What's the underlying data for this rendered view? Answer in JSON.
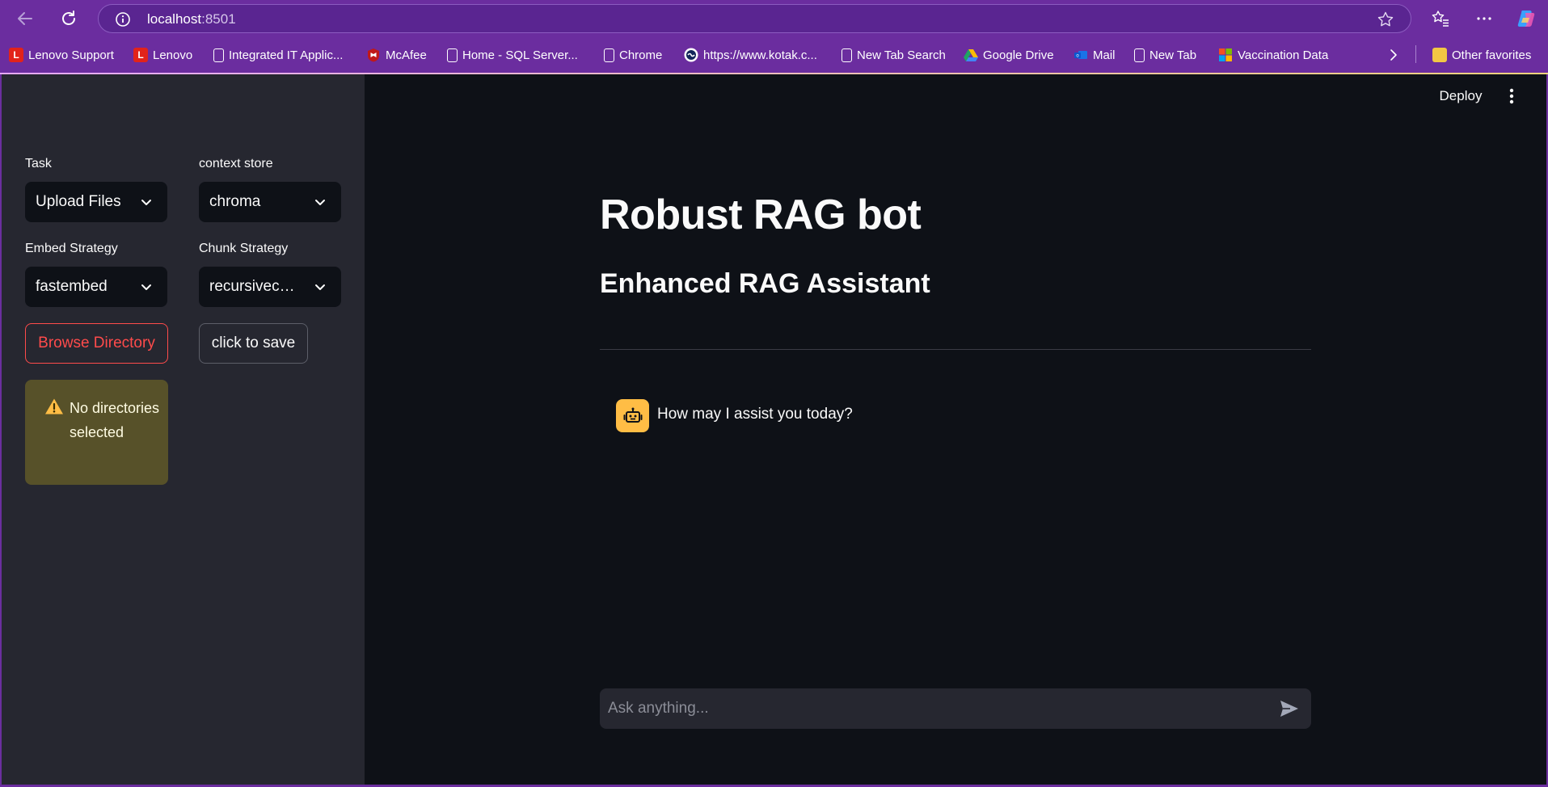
{
  "browser": {
    "url_host": "localhost",
    "url_port": ":8501",
    "bookmarks": [
      {
        "label": "Lenovo Support",
        "icon": "lenovo-icon"
      },
      {
        "label": "Lenovo",
        "icon": "lenovo-icon"
      },
      {
        "label": "Integrated IT Applic...",
        "icon": "page-icon"
      },
      {
        "label": "McAfee",
        "icon": "mcafee-icon"
      },
      {
        "label": "Home - SQL Server...",
        "icon": "page-icon"
      },
      {
        "label": "Chrome",
        "icon": "page-icon"
      },
      {
        "label": "https://www.kotak.c...",
        "icon": "kotak-icon"
      },
      {
        "label": "New Tab Search",
        "icon": "page-icon"
      },
      {
        "label": "Google Drive",
        "icon": "google-drive-icon"
      },
      {
        "label": "Mail",
        "icon": "mail-icon"
      },
      {
        "label": "New Tab",
        "icon": "page-icon"
      },
      {
        "label": "Vaccination Data",
        "icon": "microsoft-icon"
      }
    ],
    "other_favorites": "Other favorites"
  },
  "sidebar": {
    "task_label": "Task",
    "task_value": "Upload Files",
    "context_label": "context store",
    "context_value": "chroma",
    "embed_label": "Embed Strategy",
    "embed_value": "fastembed",
    "chunk_label": "Chunk Strategy",
    "chunk_value": "recursivecharacter",
    "browse_label": "Browse Directory",
    "save_label": "click to save",
    "warning": "No directories selected"
  },
  "header": {
    "deploy_label": "Deploy"
  },
  "main": {
    "title": "Robust RAG bot",
    "subtitle": "Enhanced RAG Assistant",
    "assistant_message": "How may I assist you today?",
    "input_placeholder": "Ask anything..."
  },
  "colors": {
    "browser_chrome": "#6b2d9f",
    "app_bg": "#0e1117",
    "sidebar_bg": "#262730",
    "primary": "#ff4b4b",
    "warning_bg": "#575129",
    "avatar_bg": "#ffbd45"
  }
}
